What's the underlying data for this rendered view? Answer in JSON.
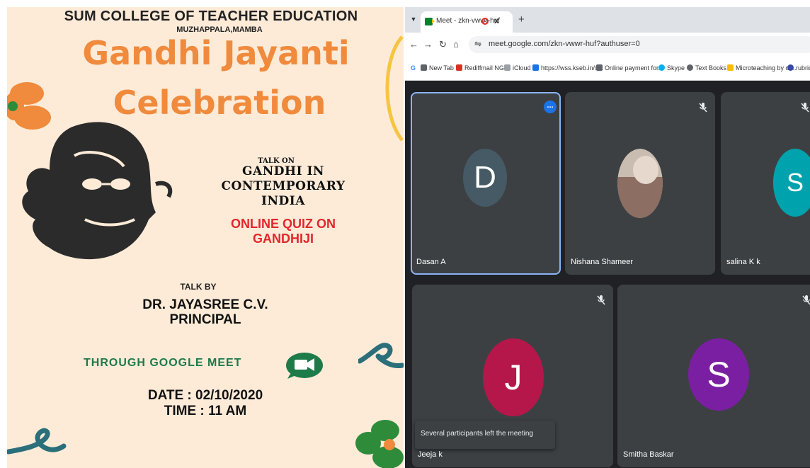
{
  "poster": {
    "college": "SUM COLLEGE OF TEACHER EDUCATION",
    "place": "MUZHAPPALA,MAMBA",
    "title_line1": "Gandhi Jayanti",
    "title_line2": "Celebration",
    "talk_on": "TALK ON",
    "topic_lines": [
      "GANDHI IN",
      "CONTEMPORARY",
      "INDIA"
    ],
    "quiz_lines": [
      "ONLINE QUIZ ON",
      "GANDHIJI"
    ],
    "talk_by": "TALK BY",
    "speaker_lines": [
      "DR. JAYASREE C.V.",
      "PRINCIPAL"
    ],
    "through": "THROUGH GOOGLE MEET",
    "date": "DATE : 02/10/2020",
    "time": "TIME : 11 AM",
    "colors": {
      "background": "#fdebd8",
      "title": "#f08a3c",
      "quiz": "#e3272b",
      "meet_text": "#1d7a49"
    }
  },
  "browser": {
    "tab_title": "Meet - zkn-vwwr-huf",
    "tab_close": "x",
    "new_tab": "+",
    "url": "meet.google.com/zkn-vwwr-huf?authuser=0",
    "nav_icons": [
      "back-icon",
      "forward-icon",
      "reload-icon",
      "home-icon"
    ],
    "bookmarks": [
      {
        "label": "G",
        "color": "#4285f4"
      },
      {
        "label": "New Tab",
        "color": "#5f6368"
      },
      {
        "label": "Rediffmail NG",
        "color": "#d93025"
      },
      {
        "label": "iCloud",
        "color": "#9aa0a6"
      },
      {
        "label": "https://wss.kseb.in/s...",
        "color": "#1a73e8"
      },
      {
        "label": "Online payment for...",
        "color": "#5f6368"
      },
      {
        "label": "Skype",
        "color": "#00aff0"
      },
      {
        "label": "Text Books",
        "color": "#5f6368"
      },
      {
        "label": "Microteaching by dr...",
        "color": "#fbbc04"
      },
      {
        "label": "rubric",
        "color": "#3949ab"
      }
    ]
  },
  "meet": {
    "participants": [
      {
        "name": "Dasan A",
        "initial": "D",
        "avatar_color": "#455a64",
        "muted": false,
        "active": true
      },
      {
        "name": "Nishana Shameer",
        "initial": "",
        "avatar_color": "#9e8a7c",
        "muted": true,
        "photo": true
      },
      {
        "name": "salina K k",
        "initial": "S",
        "avatar_color": "#00a3ad",
        "muted": true
      },
      {
        "name": "Jeeja k",
        "initial": "J",
        "avatar_color": "#b5174a",
        "muted": true
      },
      {
        "name": "Smitha Baskar",
        "initial": "S",
        "avatar_color": "#7b1fa2",
        "muted": true
      }
    ],
    "notification": "Several participants left the meeting",
    "more_options": "..."
  }
}
